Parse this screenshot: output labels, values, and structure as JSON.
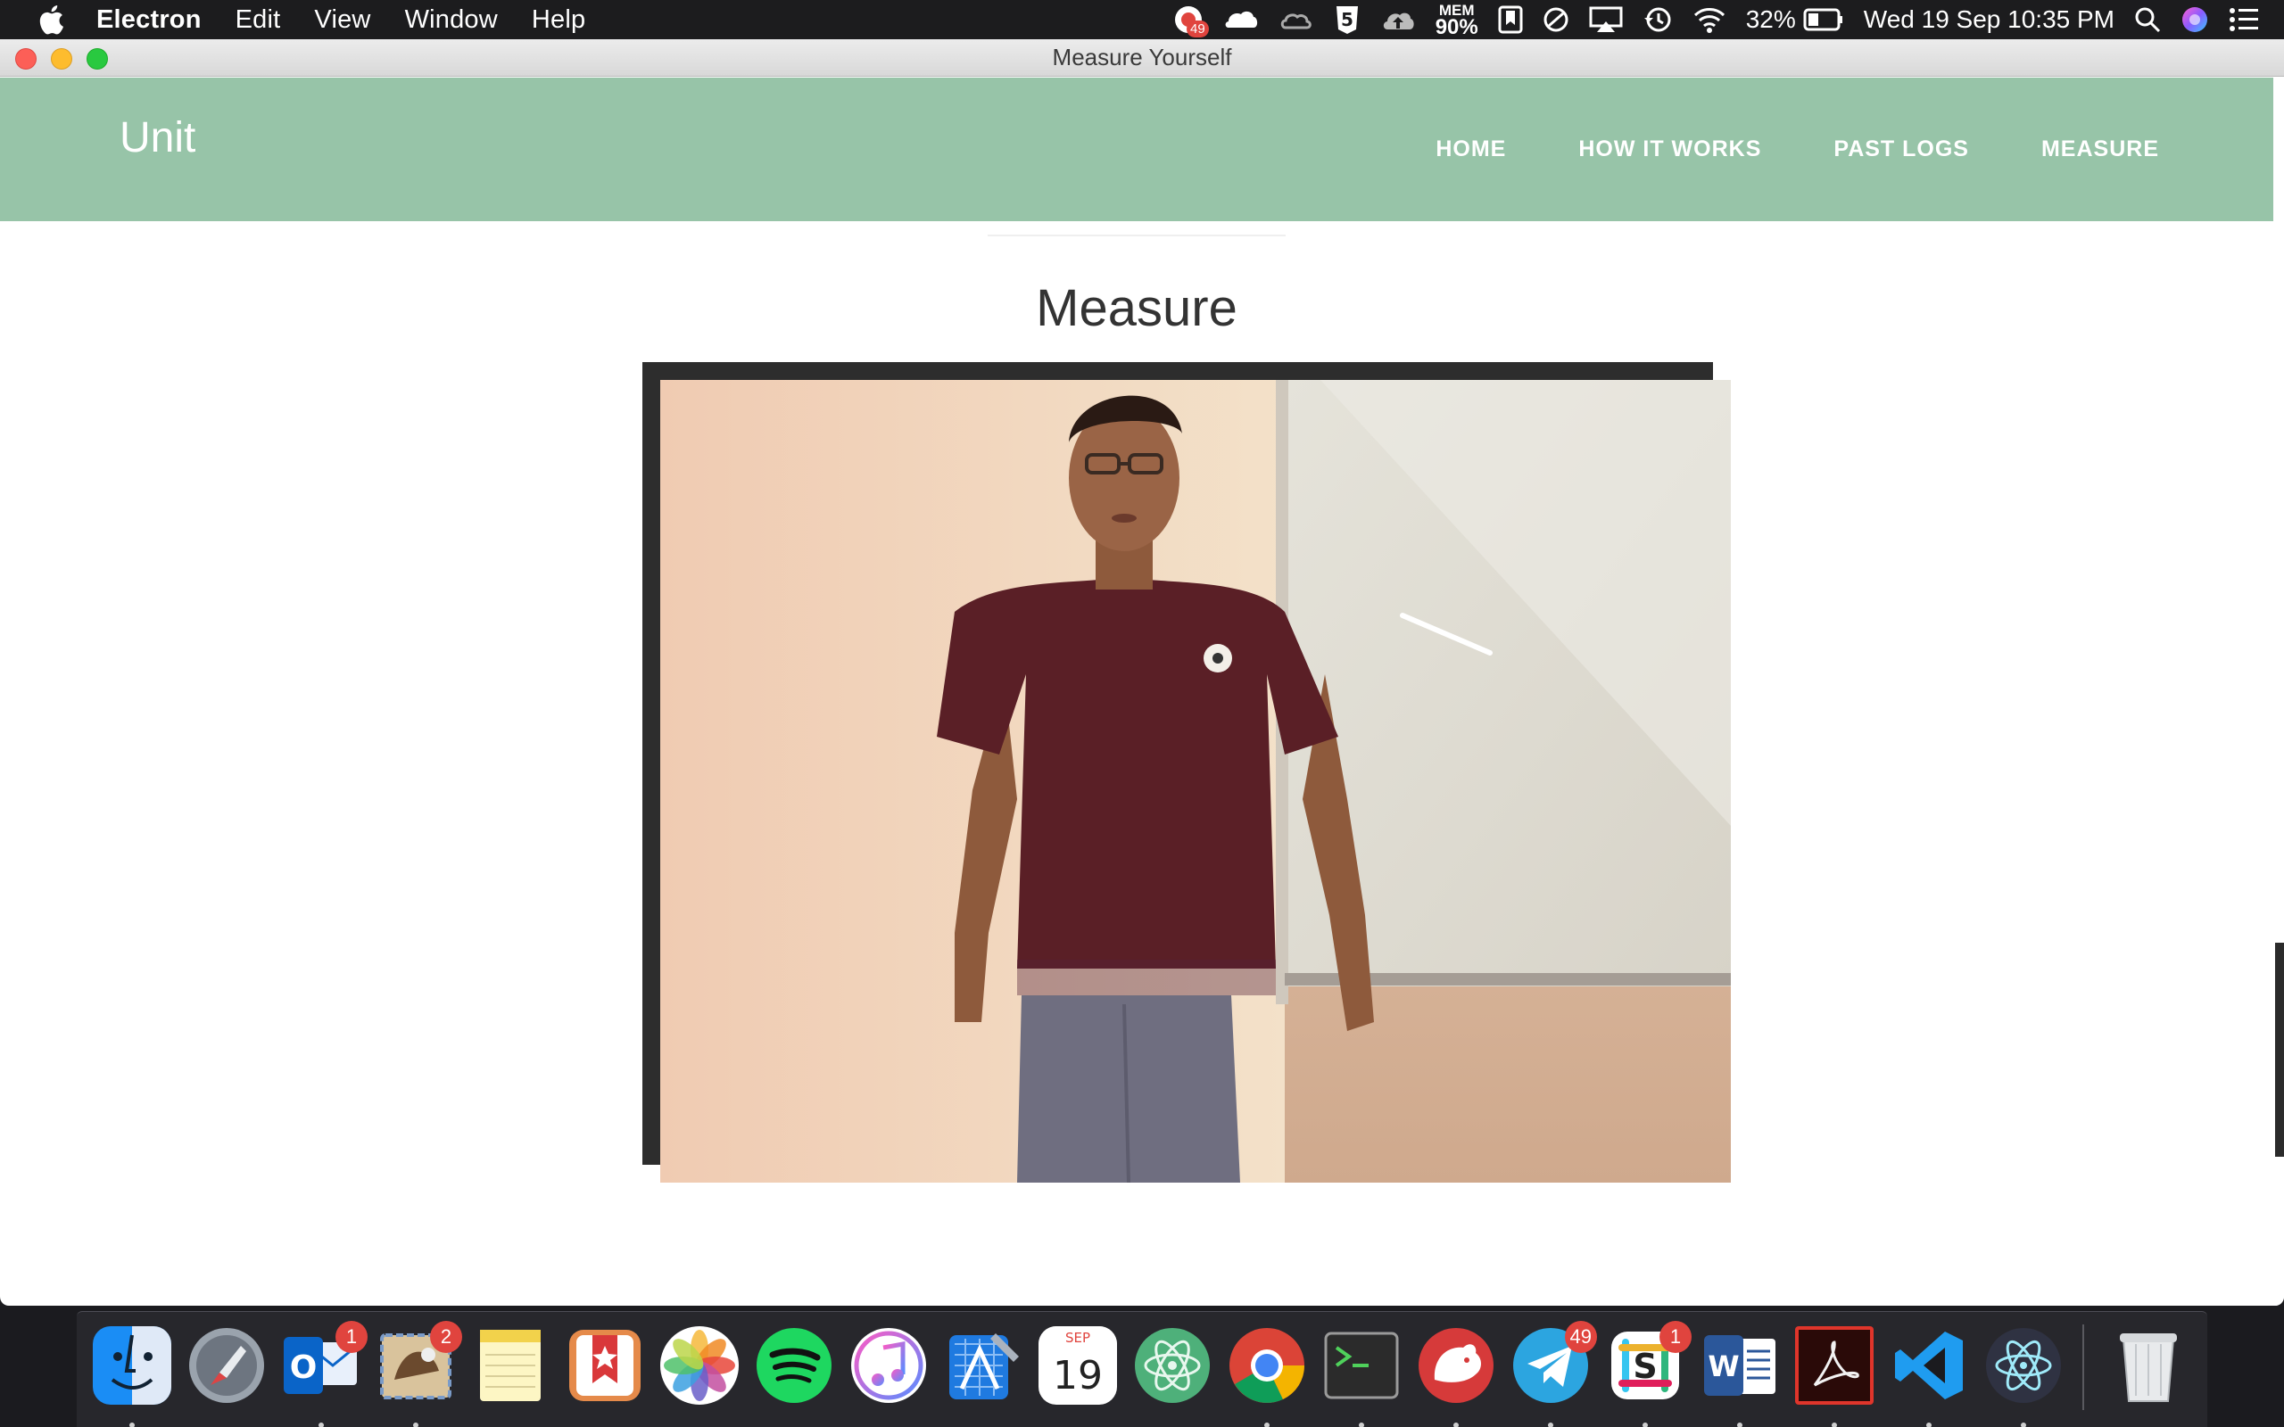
{
  "menubar": {
    "app_name": "Electron",
    "menus": [
      "Edit",
      "View",
      "Window",
      "Help"
    ],
    "status": {
      "notification_badge": "49",
      "mem_label": "MEM",
      "mem_value": "90%",
      "battery": "32%",
      "datetime": "Wed 19 Sep  10:35 PM"
    }
  },
  "window": {
    "title": "Measure Yourself"
  },
  "site": {
    "brand": "Unit",
    "nav": [
      "HOME",
      "HOW IT WORKS",
      "PAST LOGS",
      "MEASURE"
    ],
    "heading": "Measure",
    "brand_color": "#97c4a8"
  },
  "dock": {
    "items": [
      {
        "name": "finder",
        "running": true
      },
      {
        "name": "launchpad",
        "running": false
      },
      {
        "name": "outlook",
        "running": true,
        "badge": "1"
      },
      {
        "name": "mail",
        "running": true,
        "badge": "2"
      },
      {
        "name": "notes",
        "running": false
      },
      {
        "name": "wunderlist",
        "running": false
      },
      {
        "name": "photos",
        "running": false
      },
      {
        "name": "spotify",
        "running": false
      },
      {
        "name": "itunes",
        "running": false
      },
      {
        "name": "xcode",
        "running": false
      },
      {
        "name": "calendar",
        "running": false,
        "month": "SEP",
        "day": "19"
      },
      {
        "name": "atom",
        "running": false
      },
      {
        "name": "chrome",
        "running": true
      },
      {
        "name": "terminal",
        "running": true
      },
      {
        "name": "bear",
        "running": true
      },
      {
        "name": "telegram",
        "running": true,
        "badge": "49"
      },
      {
        "name": "slack",
        "running": true,
        "badge": "1"
      },
      {
        "name": "word",
        "running": true
      },
      {
        "name": "acrobat",
        "running": true
      },
      {
        "name": "vscode",
        "running": true
      },
      {
        "name": "electron",
        "running": true
      },
      {
        "name": "trash",
        "running": false
      }
    ]
  }
}
